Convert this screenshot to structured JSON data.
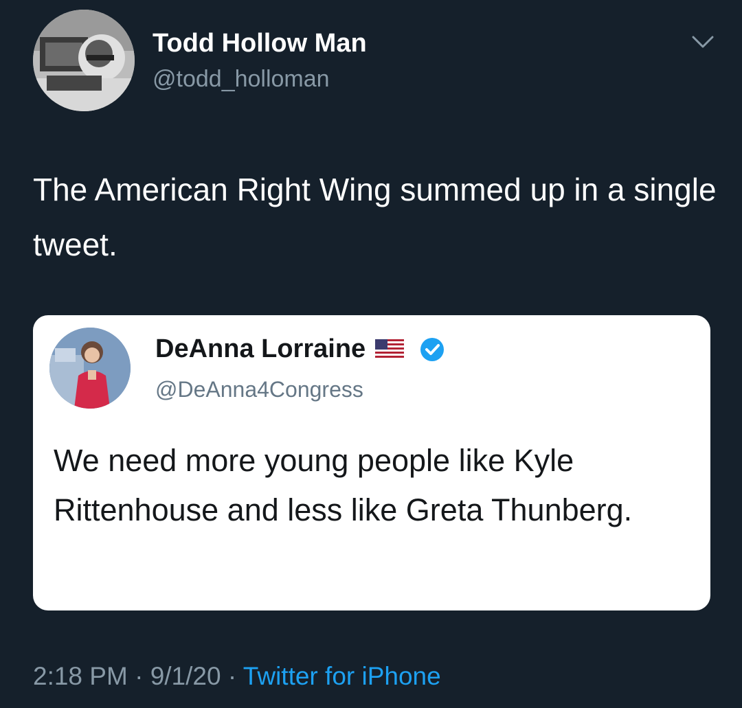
{
  "tweet": {
    "author_name": "Todd Hollow Man",
    "author_handle": "@todd_holloman",
    "text": "The American Right Wing summed up in a single tweet.",
    "time": "2:18 PM",
    "separator": "·",
    "date": "9/1/20",
    "source": "Twitter for iPhone"
  },
  "quoted_tweet": {
    "author_name": "DeAnna Lorraine",
    "author_handle": "@DeAnna4Congress",
    "text": "We need more young people like Kyle Rittenhouse and less like Greta Thunberg."
  },
  "icons": {
    "menu": "chevron-down-icon",
    "flag": "us-flag-icon",
    "verified": "verified-badge-icon"
  },
  "colors": {
    "background": "#15202b",
    "link_blue": "#1da1f2",
    "secondary_text": "#8899a6"
  }
}
